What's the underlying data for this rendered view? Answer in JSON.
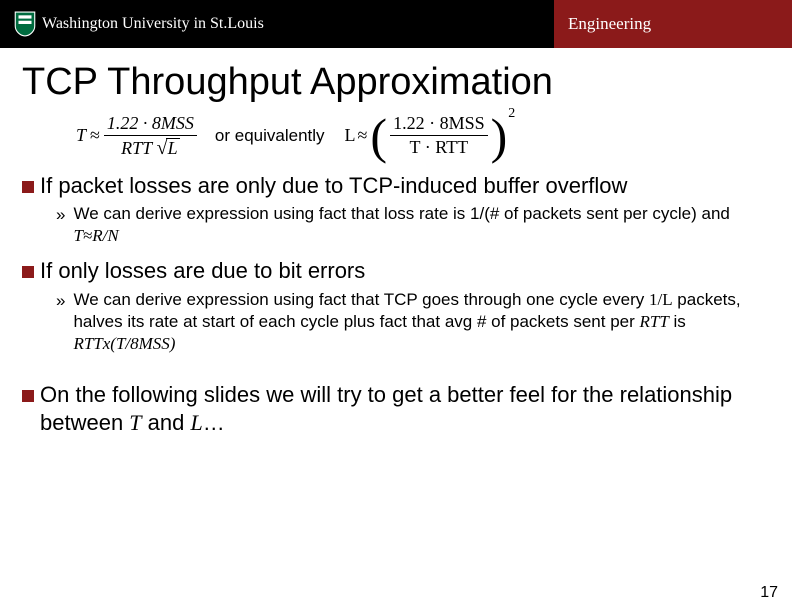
{
  "header": {
    "university_main": "Washington University in St.Louis",
    "engineering_label": "Engineering",
    "shield_name": "washu-shield-icon"
  },
  "title": "TCP Throughput Approximation",
  "formula": {
    "left_var": "T",
    "approx": "≈",
    "left_numerator": "1.22 · 8MSS",
    "left_denominator_pre": "RTT",
    "left_denominator_radicand": "L",
    "equivalently_label": "or equivalently",
    "right_var": "L",
    "right_numerator": "1.22 · 8MSS",
    "right_denominator": "T · RTT",
    "right_exponent": "2"
  },
  "bullets": [
    {
      "text": "If packet losses are only due to TCP-induced buffer overflow",
      "subs": [
        {
          "prefix": "We can derive expression using fact that loss rate is 1/(# of packets sent per cycle) and ",
          "math": "T≈R/N"
        }
      ]
    },
    {
      "text": "If only losses are due to bit errors",
      "subs": [
        {
          "prefix": "We can derive expression using fact that TCP goes through one cycle every ",
          "mid1_math": "1/L",
          "mid1_after": " packets, halves its rate at start of each cycle plus fact that avg # of packets sent per ",
          "mid2_math": "RTT",
          "mid2_after": " is ",
          "tail_math": "RTTx(T/8MSS)"
        }
      ]
    },
    {
      "text_prefix": "On the following slides we will try to get a better feel for the relationship between ",
      "text_math1": "T",
      "text_between": " and ",
      "text_math2": "L",
      "text_suffix": "…",
      "subs": []
    }
  ],
  "page_number": "17"
}
